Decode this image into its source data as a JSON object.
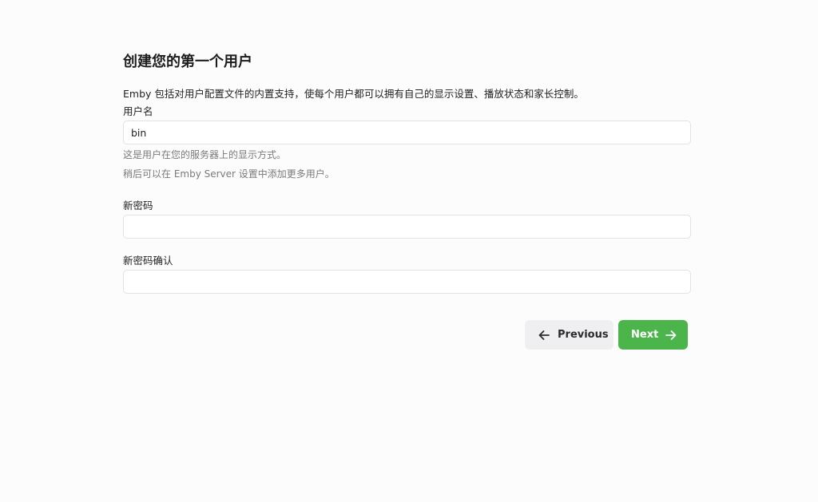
{
  "wizard": {
    "title": "创建您的第一个用户",
    "intro": "Emby 包括对用户配置文件的内置支持，使每个用户都可以拥有自己的显示设置、播放状态和家长控制。"
  },
  "form": {
    "username": {
      "label": "用户名",
      "value": "bin",
      "help_1": "这是用户在您的服务器上的显示方式。",
      "help_2": "稍后可以在 Emby Server 设置中添加更多用户。"
    },
    "password": {
      "label": "新密码",
      "value": ""
    },
    "password_confirm": {
      "label": "新密码确认",
      "value": ""
    }
  },
  "actions": {
    "previous_label": "Previous",
    "previous_icon": "arrow-left-icon",
    "next_label": "Next",
    "next_icon": "arrow-right-icon"
  },
  "colors": {
    "next_button": "#4bb54b",
    "previous_button": "#efeff1",
    "background": "#fcfcfc"
  }
}
